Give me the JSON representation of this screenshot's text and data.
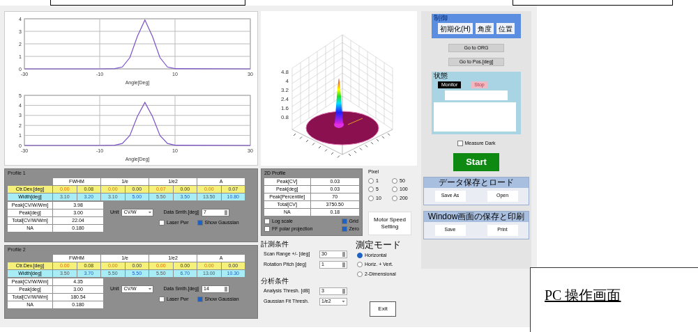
{
  "charts": [
    {
      "chart_data": {
        "type": "line",
        "xlabel": "Angle[Deg]",
        "x": [
          -30,
          -10,
          -6,
          -4,
          -2,
          0,
          2,
          4,
          6,
          8,
          10,
          30
        ],
        "xlim": [
          -30,
          30
        ],
        "ylim": [
          0,
          4
        ],
        "xticks": [
          -30,
          -10,
          10,
          30
        ],
        "yticks": [
          0,
          1,
          2,
          3,
          4
        ],
        "grid": true,
        "series": [
          {
            "color": "#7a50c8",
            "values": [
              0,
              0,
              0.02,
              0.15,
              0.9,
              2.6,
              3.9,
              2.6,
              0.9,
              0.15,
              0.02,
              0
            ]
          }
        ]
      }
    },
    {
      "chart_data": {
        "type": "line",
        "xlabel": "Angle[Deg]",
        "x": [
          -30,
          -10,
          -6,
          -4,
          -2,
          0,
          2,
          4,
          6,
          8,
          10,
          30
        ],
        "xlim": [
          -30,
          30
        ],
        "ylim": [
          0,
          5
        ],
        "xticks": [
          -30,
          -10,
          10,
          30
        ],
        "yticks": [
          0,
          1,
          2,
          3,
          4,
          5
        ],
        "grid": true,
        "series": [
          {
            "color": "#7a50c8",
            "values": [
              0,
              0,
              0.02,
              0.2,
              1.0,
              2.9,
              4.3,
              2.9,
              1.0,
              0.2,
              0.02,
              0
            ]
          }
        ]
      }
    }
  ],
  "surface_plot": {
    "z_ticks": [
      "4.8",
      "4",
      "3.2",
      "2.4",
      "1.6",
      "0.8"
    ]
  },
  "control_group": {
    "title": "制御",
    "buttons": [
      "初期化(H)",
      "角度",
      "位置"
    ]
  },
  "nav_buttons": [
    "Go to ORG",
    "Go to Pos.[deg]"
  ],
  "status_group": {
    "title": "状態",
    "indicators": [
      {
        "label": "Monitor",
        "on": true
      },
      {
        "label": "Stop",
        "on": false
      }
    ]
  },
  "measure_dark": {
    "label": "Measure Dark",
    "checked": false
  },
  "start_button": "Start",
  "data_group": {
    "title": "データ保存とロード",
    "buttons": [
      "Save As",
      "Open"
    ]
  },
  "window_group": {
    "title": "Window画面の保存と印刷",
    "buttons": [
      "Save",
      "Print"
    ]
  },
  "profiles": [
    {
      "title": "Profile 1",
      "columns": [
        "FWHM",
        "1/e",
        "1/e2",
        "A"
      ],
      "rows": [
        {
          "label": "Ctr.Dev.[deg]",
          "kind": "center",
          "values": [
            "0.00",
            "0.08",
            "0.00",
            "0.00",
            "0.07",
            "0.00",
            "0.00",
            "0.07"
          ]
        },
        {
          "label": "Width[deg]",
          "kind": "width",
          "values": [
            "3.10",
            "3.20",
            "3.10",
            "5.00",
            "5.50",
            "3.50",
            "13.50",
            "10.80"
          ]
        }
      ],
      "stats": [
        {
          "label": "Peak[CV/W/Wm]",
          "value": "3.98"
        },
        {
          "label": "Peak[deg]",
          "value": "3.00"
        },
        {
          "label": "Total[CV/W/Wm]",
          "value": "22.04"
        },
        {
          "label": "NA",
          "value": "0.180"
        }
      ],
      "unit": {
        "label": "Unit",
        "value": "CV/W"
      },
      "smoothing": {
        "label": "Data Smth.[deg]",
        "value": "7"
      },
      "checks": [
        {
          "label": "Laser Pwr",
          "checked": false
        },
        {
          "label": "Show Gaussian",
          "checked": true
        }
      ]
    },
    {
      "title": "Profile 2",
      "columns": [
        "FWHM",
        "1/e",
        "1/e2",
        "A"
      ],
      "rows": [
        {
          "label": "Ctr.Dev.[deg]",
          "kind": "center",
          "values": [
            "0.00",
            "0.08",
            "0.00",
            "0.00",
            "0.00",
            "0.00",
            "0.00",
            "0.00"
          ]
        },
        {
          "label": "Width[deg]",
          "kind": "width",
          "values": [
            "3.50",
            "3.70",
            "5.50",
            "5.50",
            "5.50",
            "6.70",
            "13.00",
            "10.30"
          ]
        }
      ],
      "stats": [
        {
          "label": "Peak[CV/W/Wm]",
          "value": "4.35"
        },
        {
          "label": "Peak[deg]",
          "value": "3.00"
        },
        {
          "label": "Total[CV/W/Wm]",
          "value": "180.54"
        },
        {
          "label": "NA",
          "value": "0.180"
        }
      ],
      "unit": {
        "label": "Unit",
        "value": "CV/W"
      },
      "smoothing": {
        "label": "Data Smth.[deg]",
        "value": "14"
      },
      "checks": [
        {
          "label": "Laser Pwr",
          "checked": false
        },
        {
          "label": "Show Gaussian",
          "checked": true
        }
      ]
    }
  ],
  "profile_2d": {
    "title": "2D Profile",
    "stats": [
      {
        "label": "Peak[CV]",
        "value": "0.03"
      },
      {
        "label": "Peak[deg]",
        "value": "0.03"
      },
      {
        "label": "Peak[Percentile]",
        "value": "70"
      },
      {
        "label": "Total[CV]",
        "value": "3750.50"
      },
      {
        "label": "NA",
        "value": "0.18"
      }
    ],
    "checks": [
      {
        "label": "Log scale",
        "checked": false
      },
      {
        "label": "Grid",
        "checked": true
      },
      {
        "label": "FF polar projection",
        "checked": false
      },
      {
        "label": "Zero",
        "checked": true
      }
    ]
  },
  "pixel": {
    "title": "Pixel",
    "options": [
      {
        "label": "1",
        "selected": false
      },
      {
        "label": "50",
        "selected": false
      },
      {
        "label": "5",
        "selected": false
      },
      {
        "label": "100",
        "selected": false
      },
      {
        "label": "10",
        "selected": false
      },
      {
        "label": "200",
        "selected": false
      }
    ]
  },
  "motor_button": "Motor Speed Setting",
  "measure_conditions": {
    "title": "計測条件",
    "fields": [
      {
        "label": "Scan Range +/- [deg]",
        "value": "30",
        "kind": "spinner"
      },
      {
        "label": "Rotation Pitch [deg]",
        "value": "1",
        "kind": "spinner"
      }
    ]
  },
  "measure_mode": {
    "title": "測定モード",
    "options": [
      {
        "label": "Horizontal",
        "selected": true
      },
      {
        "label": "Horiz. + Vert.",
        "selected": false
      },
      {
        "label": "2-Dimensional",
        "selected": false
      }
    ]
  },
  "analysis_conditions": {
    "title": "分析条件",
    "fields": [
      {
        "label": "Analysis Thresh. [dB]",
        "value": "3",
        "kind": "spinner"
      },
      {
        "label": "Gaussian Fit Thresh.",
        "value": "1/e2",
        "kind": "dropdown"
      }
    ]
  },
  "exit_button": "Exit",
  "caption": "PC 操作画面"
}
